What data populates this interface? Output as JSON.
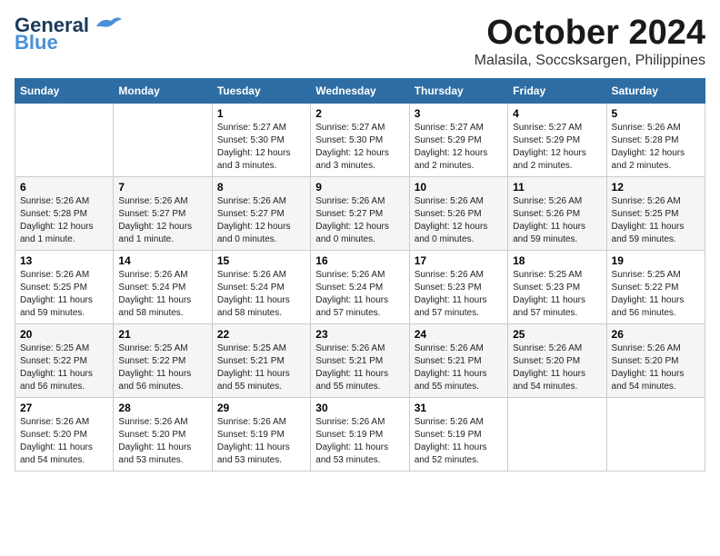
{
  "logo": {
    "line1": "General",
    "line2": "Blue"
  },
  "title": "October 2024",
  "subtitle": "Malasila, Soccsksargen, Philippines",
  "headers": [
    "Sunday",
    "Monday",
    "Tuesday",
    "Wednesday",
    "Thursday",
    "Friday",
    "Saturday"
  ],
  "weeks": [
    [
      {
        "day": "",
        "info": ""
      },
      {
        "day": "",
        "info": ""
      },
      {
        "day": "1",
        "info": "Sunrise: 5:27 AM\nSunset: 5:30 PM\nDaylight: 12 hours and 3 minutes."
      },
      {
        "day": "2",
        "info": "Sunrise: 5:27 AM\nSunset: 5:30 PM\nDaylight: 12 hours and 3 minutes."
      },
      {
        "day": "3",
        "info": "Sunrise: 5:27 AM\nSunset: 5:29 PM\nDaylight: 12 hours and 2 minutes."
      },
      {
        "day": "4",
        "info": "Sunrise: 5:27 AM\nSunset: 5:29 PM\nDaylight: 12 hours and 2 minutes."
      },
      {
        "day": "5",
        "info": "Sunrise: 5:26 AM\nSunset: 5:28 PM\nDaylight: 12 hours and 2 minutes."
      }
    ],
    [
      {
        "day": "6",
        "info": "Sunrise: 5:26 AM\nSunset: 5:28 PM\nDaylight: 12 hours and 1 minute."
      },
      {
        "day": "7",
        "info": "Sunrise: 5:26 AM\nSunset: 5:27 PM\nDaylight: 12 hours and 1 minute."
      },
      {
        "day": "8",
        "info": "Sunrise: 5:26 AM\nSunset: 5:27 PM\nDaylight: 12 hours and 0 minutes."
      },
      {
        "day": "9",
        "info": "Sunrise: 5:26 AM\nSunset: 5:27 PM\nDaylight: 12 hours and 0 minutes."
      },
      {
        "day": "10",
        "info": "Sunrise: 5:26 AM\nSunset: 5:26 PM\nDaylight: 12 hours and 0 minutes."
      },
      {
        "day": "11",
        "info": "Sunrise: 5:26 AM\nSunset: 5:26 PM\nDaylight: 11 hours and 59 minutes."
      },
      {
        "day": "12",
        "info": "Sunrise: 5:26 AM\nSunset: 5:25 PM\nDaylight: 11 hours and 59 minutes."
      }
    ],
    [
      {
        "day": "13",
        "info": "Sunrise: 5:26 AM\nSunset: 5:25 PM\nDaylight: 11 hours and 59 minutes."
      },
      {
        "day": "14",
        "info": "Sunrise: 5:26 AM\nSunset: 5:24 PM\nDaylight: 11 hours and 58 minutes."
      },
      {
        "day": "15",
        "info": "Sunrise: 5:26 AM\nSunset: 5:24 PM\nDaylight: 11 hours and 58 minutes."
      },
      {
        "day": "16",
        "info": "Sunrise: 5:26 AM\nSunset: 5:24 PM\nDaylight: 11 hours and 57 minutes."
      },
      {
        "day": "17",
        "info": "Sunrise: 5:26 AM\nSunset: 5:23 PM\nDaylight: 11 hours and 57 minutes."
      },
      {
        "day": "18",
        "info": "Sunrise: 5:25 AM\nSunset: 5:23 PM\nDaylight: 11 hours and 57 minutes."
      },
      {
        "day": "19",
        "info": "Sunrise: 5:25 AM\nSunset: 5:22 PM\nDaylight: 11 hours and 56 minutes."
      }
    ],
    [
      {
        "day": "20",
        "info": "Sunrise: 5:25 AM\nSunset: 5:22 PM\nDaylight: 11 hours and 56 minutes."
      },
      {
        "day": "21",
        "info": "Sunrise: 5:25 AM\nSunset: 5:22 PM\nDaylight: 11 hours and 56 minutes."
      },
      {
        "day": "22",
        "info": "Sunrise: 5:25 AM\nSunset: 5:21 PM\nDaylight: 11 hours and 55 minutes."
      },
      {
        "day": "23",
        "info": "Sunrise: 5:26 AM\nSunset: 5:21 PM\nDaylight: 11 hours and 55 minutes."
      },
      {
        "day": "24",
        "info": "Sunrise: 5:26 AM\nSunset: 5:21 PM\nDaylight: 11 hours and 55 minutes."
      },
      {
        "day": "25",
        "info": "Sunrise: 5:26 AM\nSunset: 5:20 PM\nDaylight: 11 hours and 54 minutes."
      },
      {
        "day": "26",
        "info": "Sunrise: 5:26 AM\nSunset: 5:20 PM\nDaylight: 11 hours and 54 minutes."
      }
    ],
    [
      {
        "day": "27",
        "info": "Sunrise: 5:26 AM\nSunset: 5:20 PM\nDaylight: 11 hours and 54 minutes."
      },
      {
        "day": "28",
        "info": "Sunrise: 5:26 AM\nSunset: 5:20 PM\nDaylight: 11 hours and 53 minutes."
      },
      {
        "day": "29",
        "info": "Sunrise: 5:26 AM\nSunset: 5:19 PM\nDaylight: 11 hours and 53 minutes."
      },
      {
        "day": "30",
        "info": "Sunrise: 5:26 AM\nSunset: 5:19 PM\nDaylight: 11 hours and 53 minutes."
      },
      {
        "day": "31",
        "info": "Sunrise: 5:26 AM\nSunset: 5:19 PM\nDaylight: 11 hours and 52 minutes."
      },
      {
        "day": "",
        "info": ""
      },
      {
        "day": "",
        "info": ""
      }
    ]
  ]
}
